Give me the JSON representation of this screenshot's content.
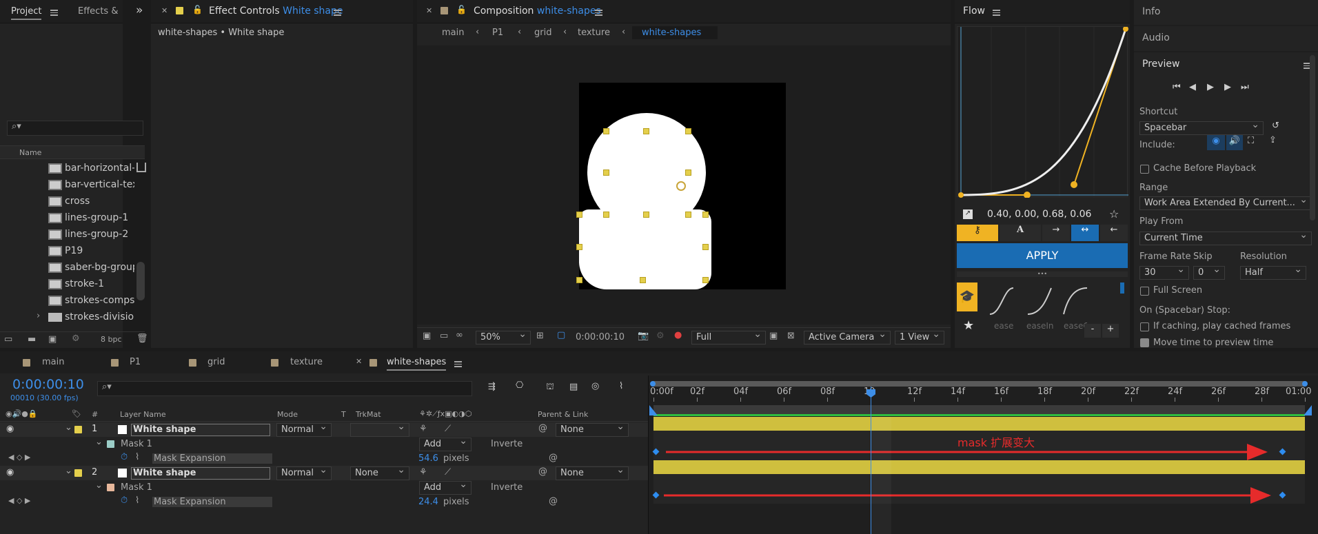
{
  "project": {
    "tab1": "Project",
    "tab2": "Effects &",
    "col_name": "Name",
    "items": [
      "bar-horizontal-te",
      "bar-vertical-text",
      "cross",
      "lines-group-1",
      "lines-group-2",
      "P19",
      "saber-bg-group",
      "stroke-1",
      "strokes-comps",
      "strokes-division"
    ],
    "bpc": "8 bpc"
  },
  "effect_controls": {
    "title": "Effect Controls",
    "layer": "White shape",
    "breadcrumb": "white-shapes • White shape"
  },
  "composition": {
    "title": "Composition",
    "name": "white-shapes",
    "crumbs": [
      "main",
      "P1",
      "grid",
      "texture",
      "white-shapes"
    ],
    "zoom": "50%",
    "timecode": "0:00:00:10",
    "quality": "Full",
    "camera": "Active Camera",
    "views": "1 View"
  },
  "flow": {
    "title": "Flow",
    "values": "0.40, 0.00, 0.68, 0.06",
    "apply": "APPLY",
    "presets": [
      "ease",
      "easeIn",
      "easeO"
    ],
    "minus": "-",
    "plus": "+",
    "colors": {
      "accent": "#f0b323",
      "apply_bg": "#1a6cb3"
    }
  },
  "right": {
    "info": "Info",
    "audio": "Audio",
    "preview": "Preview",
    "shortcut_label": "Shortcut",
    "shortcut": "Spacebar",
    "include": "Include:",
    "cache_before": "Cache Before Playback",
    "range_label": "Range",
    "range": "Work Area Extended By Current...",
    "play_from_label": "Play From",
    "play_from": "Current Time",
    "frame_rate_label": "Frame Rate",
    "skip_label": "Skip",
    "resolution_label": "Resolution",
    "frame_rate": "30",
    "skip": "0",
    "resolution": "Half",
    "full_screen": "Full Screen",
    "stop_label": "On (Spacebar) Stop:",
    "if_caching": "If caching, play cached frames",
    "move_time": "Move time to preview time"
  },
  "timeline": {
    "tabs": [
      "main",
      "P1",
      "grid",
      "texture",
      "white-shapes"
    ],
    "timecode": "0:00:00:10",
    "frames": "00010 (30.00 fps)",
    "cols": {
      "name": "Layer Name",
      "mode": "Mode",
      "t": "T",
      "trkmat": "TrkMat",
      "parent": "Parent & Link"
    },
    "ticks": [
      "0:00f",
      "02f",
      "04f",
      "06f",
      "08f",
      "10",
      "12f",
      "14f",
      "16f",
      "18f",
      "20f",
      "22f",
      "24f",
      "26f",
      "28f",
      "01:00"
    ],
    "layers": [
      {
        "num": "1",
        "name": "White shape",
        "mode": "Normal",
        "trkmat": "",
        "parent": "None",
        "mask": "Mask 1",
        "mask_mode": "Add",
        "inverted": "Inverte",
        "prop": "Mask Expansion",
        "value": "54.6",
        "unit": "pixels"
      },
      {
        "num": "2",
        "name": "White shape",
        "mode": "Normal",
        "trkmat": "None",
        "parent": "None",
        "mask": "Mask 1",
        "mask_mode": "Add",
        "inverted": "Inverte",
        "prop": "Mask Expansion",
        "value": "24.4",
        "unit": "pixels"
      }
    ],
    "annotation": "mask 扩展变大"
  }
}
